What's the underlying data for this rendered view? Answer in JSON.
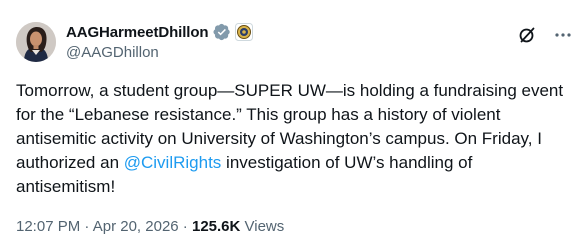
{
  "author": {
    "display_name": "AAGHarmeetDhillon",
    "handle": "@AAGDhillon"
  },
  "tweet": {
    "text_before": "Tomorrow, a student group—SUPER UW—is holding a fundraising event for the “Lebanese resistance.” This group has a history of violent antisemitic activity on University of Washington’s campus. On Friday, I authorized an ",
    "mention": "@CivilRights",
    "text_after": " investigation of UW’s handling of antisemitism!"
  },
  "meta": {
    "time": "12:07 PM",
    "separator": " · ",
    "date": "Apr 20, 2026",
    "separator2": " · ",
    "views_count": "125.6K",
    "views_label": " Views"
  },
  "icons": {
    "verified": "verified-badge-icon",
    "affiliation": "government-seal-icon",
    "grok": "grok-icon",
    "more": "more-icon"
  },
  "colors": {
    "link": "#1d9bf0",
    "secondary": "#536471",
    "verified_gray": "#829aab",
    "primary_text": "#0f1419"
  }
}
